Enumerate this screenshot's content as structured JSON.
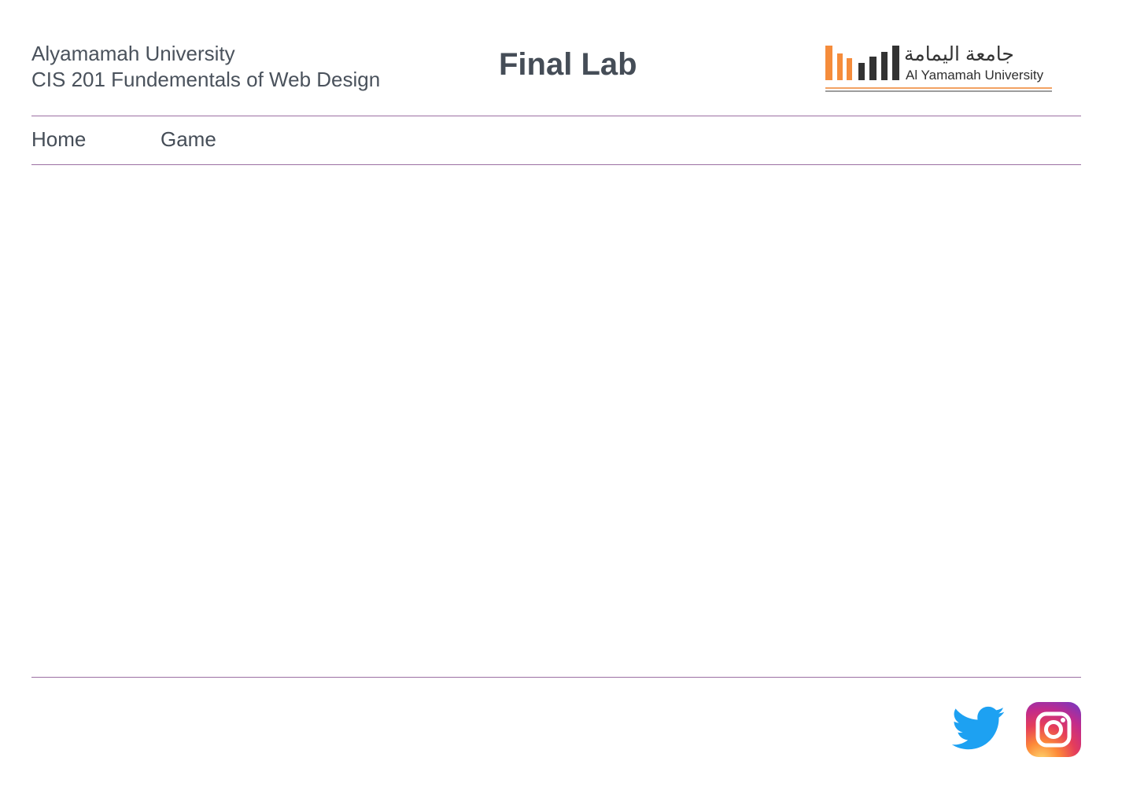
{
  "header": {
    "university_name": "Alyamamah University",
    "course_name": "CIS 201 Fundementals of Web Design",
    "page_title": "Final Lab",
    "logo": {
      "arabic_text": "جامعة اليمامة",
      "english_text": "Al Yamamah University",
      "bar_colors": [
        "#f58c3b",
        "#f58c3b",
        "#f58c3b",
        "#333333",
        "#333333",
        "#333333",
        "#333333"
      ]
    }
  },
  "nav": {
    "items": [
      {
        "label": "Home"
      },
      {
        "label": "Game"
      }
    ]
  },
  "footer": {
    "social": [
      {
        "icon": "twitter-icon",
        "color": "#1da1f2"
      },
      {
        "icon": "instagram-icon",
        "color": "#e1306c"
      }
    ]
  },
  "colors": {
    "text": "#454d57",
    "rule": "#9c6fa2",
    "background": "#ffffff"
  }
}
